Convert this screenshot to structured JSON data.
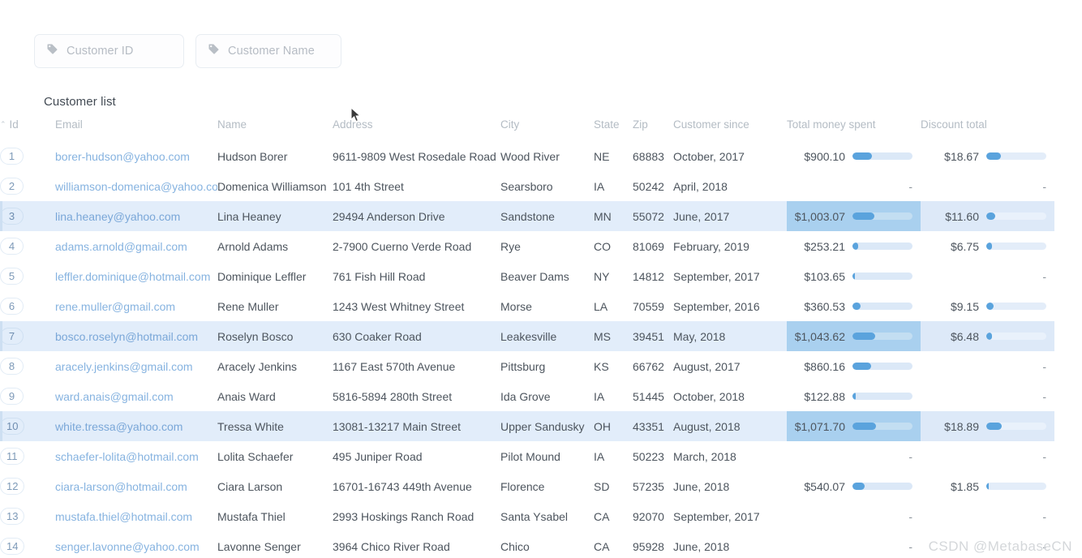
{
  "filters": {
    "icon": "tag-icon",
    "customer_id": {
      "label": "Customer ID",
      "placeholder": "Customer ID",
      "value": ""
    },
    "customer_name": {
      "label": "Customer Name",
      "placeholder": "Customer Name",
      "value": ""
    }
  },
  "section": {
    "title": "Customer list"
  },
  "table": {
    "sort_indicator": "⌃",
    "columns": [
      {
        "key": "id",
        "label": "Id"
      },
      {
        "key": "email",
        "label": "Email"
      },
      {
        "key": "name",
        "label": "Name"
      },
      {
        "key": "address",
        "label": "Address"
      },
      {
        "key": "city",
        "label": "City"
      },
      {
        "key": "state",
        "label": "State"
      },
      {
        "key": "zip",
        "label": "Zip"
      },
      {
        "key": "since",
        "label": "Customer since"
      },
      {
        "key": "spent",
        "label": "Total money spent"
      },
      {
        "key": "discount",
        "label": "Discount total"
      }
    ],
    "empty_value": "-",
    "rows": [
      {
        "id": "1",
        "email": "borer-hudson@yahoo.com",
        "name": "Hudson Borer",
        "address": "9611-9809 West Rosedale Road",
        "city": "Wood River",
        "state": "NE",
        "zip": "68883",
        "since": "October, 2017",
        "spent": "$900.10",
        "spent_pct": 33,
        "discount": "$18.67",
        "discount_pct": 24,
        "highlighted": false
      },
      {
        "id": "2",
        "email": "williamson-domenica@yahoo.com",
        "name": "Domenica Williamson",
        "address": "101 4th Street",
        "city": "Searsboro",
        "state": "IA",
        "zip": "50242",
        "since": "April, 2018",
        "spent": null,
        "spent_pct": null,
        "discount": null,
        "discount_pct": null,
        "highlighted": false
      },
      {
        "id": "3",
        "email": "lina.heaney@yahoo.com",
        "name": "Lina Heaney",
        "address": "29494 Anderson Drive",
        "city": "Sandstone",
        "state": "MN",
        "zip": "55072",
        "since": "June, 2017",
        "spent": "$1,003.07",
        "spent_pct": 37,
        "discount": "$11.60",
        "discount_pct": 15,
        "highlighted": true
      },
      {
        "id": "4",
        "email": "adams.arnold@gmail.com",
        "name": "Arnold Adams",
        "address": "2-7900 Cuerno Verde Road",
        "city": "Rye",
        "state": "CO",
        "zip": "81069",
        "since": "February, 2019",
        "spent": "$253.21",
        "spent_pct": 9,
        "discount": "$6.75",
        "discount_pct": 9,
        "highlighted": false
      },
      {
        "id": "5",
        "email": "leffler.dominique@hotmail.com",
        "name": "Dominique Leffler",
        "address": "761 Fish Hill Road",
        "city": "Beaver Dams",
        "state": "NY",
        "zip": "14812",
        "since": "September, 2017",
        "spent": "$103.65",
        "spent_pct": 4,
        "discount": null,
        "discount_pct": null,
        "highlighted": false
      },
      {
        "id": "6",
        "email": "rene.muller@gmail.com",
        "name": "Rene Muller",
        "address": "1243 West Whitney Street",
        "city": "Morse",
        "state": "LA",
        "zip": "70559",
        "since": "September, 2016",
        "spent": "$360.53",
        "spent_pct": 13,
        "discount": "$9.15",
        "discount_pct": 12,
        "highlighted": false
      },
      {
        "id": "7",
        "email": "bosco.roselyn@hotmail.com",
        "name": "Roselyn Bosco",
        "address": "630 Coaker Road",
        "city": "Leakesville",
        "state": "MS",
        "zip": "39451",
        "since": "May, 2018",
        "spent": "$1,043.62",
        "spent_pct": 38,
        "discount": "$6.48",
        "discount_pct": 9,
        "highlighted": true
      },
      {
        "id": "8",
        "email": "aracely.jenkins@gmail.com",
        "name": "Aracely Jenkins",
        "address": "1167 East 570th Avenue",
        "city": "Pittsburg",
        "state": "KS",
        "zip": "66762",
        "since": "August, 2017",
        "spent": "$860.16",
        "spent_pct": 31,
        "discount": null,
        "discount_pct": null,
        "highlighted": false
      },
      {
        "id": "9",
        "email": "ward.anais@gmail.com",
        "name": "Anais Ward",
        "address": "5816-5894 280th Street",
        "city": "Ida Grove",
        "state": "IA",
        "zip": "51445",
        "since": "October, 2018",
        "spent": "$122.88",
        "spent_pct": 5,
        "discount": null,
        "discount_pct": null,
        "highlighted": false
      },
      {
        "id": "10",
        "email": "white.tressa@yahoo.com",
        "name": "Tressa White",
        "address": "13081-13217 Main Street",
        "city": "Upper Sandusky",
        "state": "OH",
        "zip": "43351",
        "since": "August, 2018",
        "spent": "$1,071.70",
        "spent_pct": 39,
        "discount": "$18.89",
        "discount_pct": 25,
        "highlighted": true
      },
      {
        "id": "11",
        "email": "schaefer-lolita@hotmail.com",
        "name": "Lolita Schaefer",
        "address": "495 Juniper Road",
        "city": "Pilot Mound",
        "state": "IA",
        "zip": "50223",
        "since": "March, 2018",
        "spent": null,
        "spent_pct": null,
        "discount": null,
        "discount_pct": null,
        "highlighted": false
      },
      {
        "id": "12",
        "email": "ciara-larson@hotmail.com",
        "name": "Ciara Larson",
        "address": "16701-16743 449th Avenue",
        "city": "Florence",
        "state": "SD",
        "zip": "57235",
        "since": "June, 2018",
        "spent": "$540.07",
        "spent_pct": 20,
        "discount": "$1.85",
        "discount_pct": 3,
        "highlighted": false
      },
      {
        "id": "13",
        "email": "mustafa.thiel@hotmail.com",
        "name": "Mustafa Thiel",
        "address": "2993 Hoskings Ranch Road",
        "city": "Santa Ysabel",
        "state": "CA",
        "zip": "92070",
        "since": "September, 2017",
        "spent": null,
        "spent_pct": null,
        "discount": null,
        "discount_pct": null,
        "highlighted": false
      },
      {
        "id": "14",
        "email": "senger.lavonne@yahoo.com",
        "name": "Lavonne Senger",
        "address": "3964 Chico River Road",
        "city": "Chico",
        "state": "CA",
        "zip": "95928",
        "since": "June, 2018",
        "spent": null,
        "spent_pct": null,
        "discount": null,
        "discount_pct": null,
        "highlighted": false
      }
    ]
  },
  "watermark": {
    "text": "CSDN @MetabaseCN"
  },
  "colors": {
    "accent": "#5aa3dd",
    "bar_track": "#dbe8f7",
    "row_highlight": "#e2edfa",
    "cell_highlight": "#a9d0ef",
    "link": "#86b3e0",
    "header_text": "#b4bcc4",
    "body_text": "#4d555e"
  }
}
